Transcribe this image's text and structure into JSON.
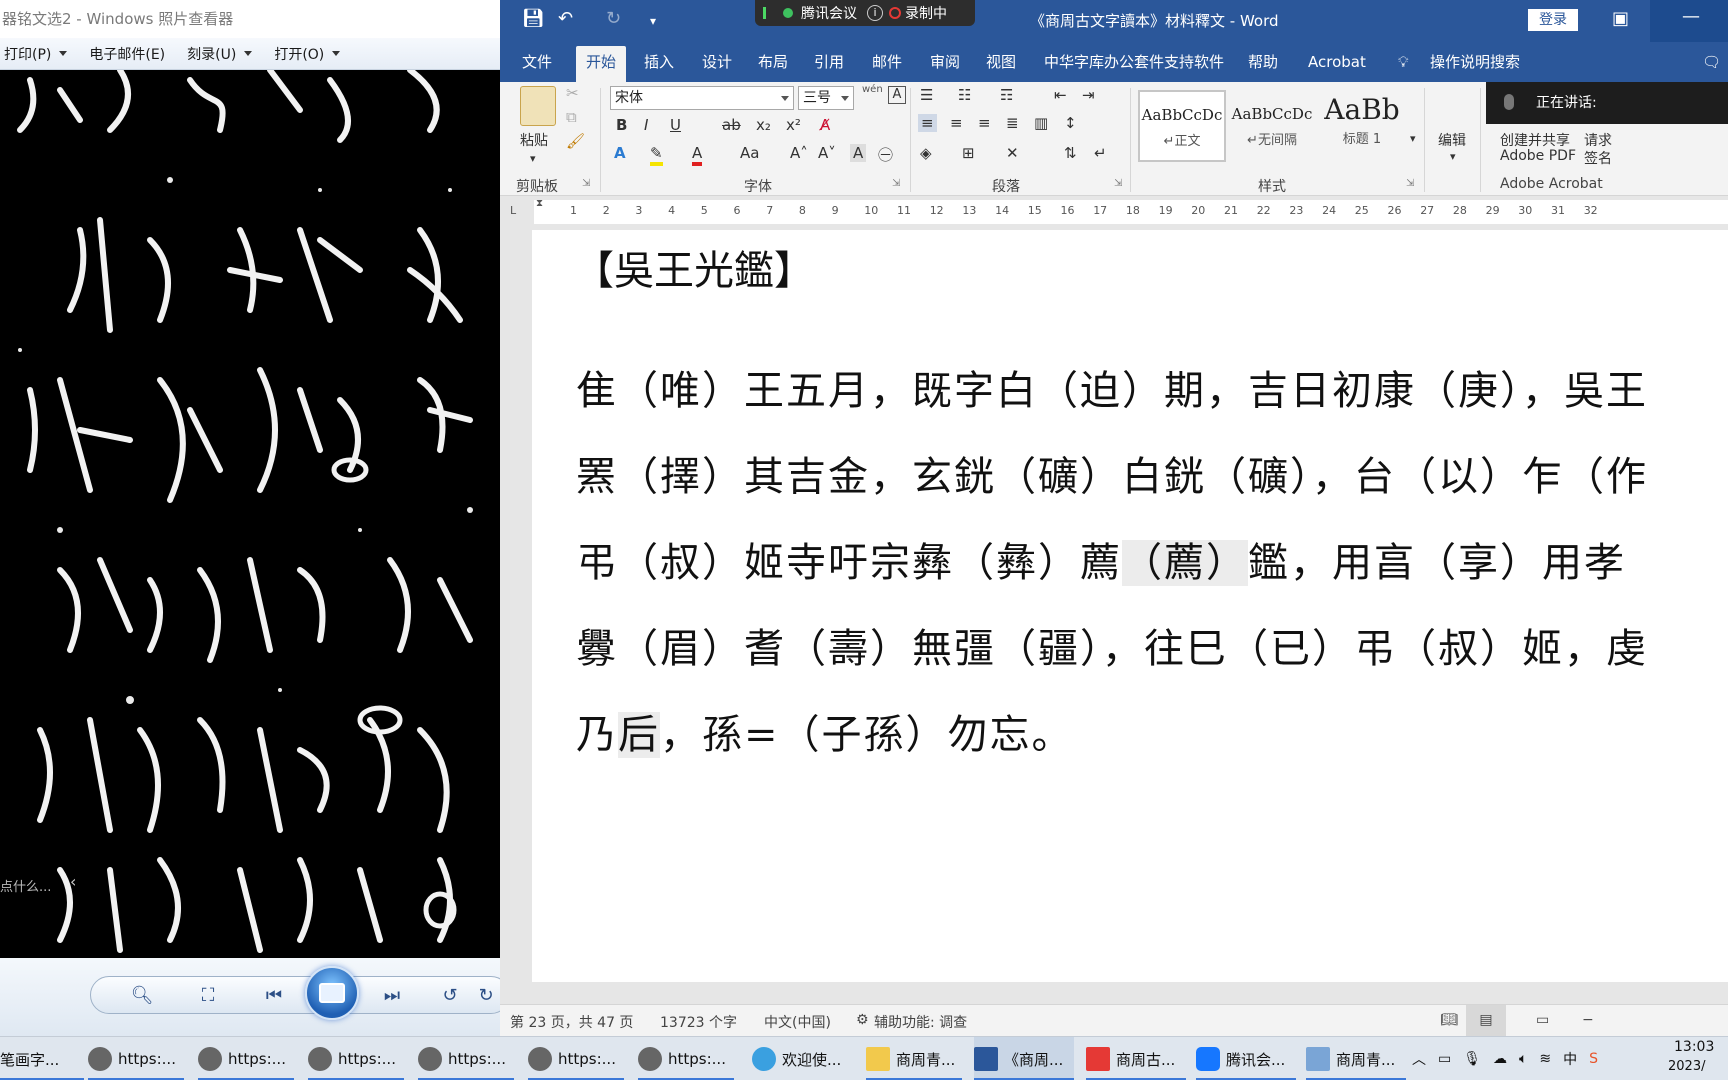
{
  "photo_viewer": {
    "title": "器铭文选2 - Windows 照片查看器",
    "menus": [
      {
        "label": "打印(P)"
      },
      {
        "label": "电子邮件(E)"
      },
      {
        "label": "刻录(U)"
      },
      {
        "label": "打开(O)"
      }
    ],
    "side_hint": "点什么..."
  },
  "word": {
    "window_title": "《商周古文字讀本》材料釋文 - Word",
    "login_label": "登录",
    "meeting": {
      "app": "腾讯会议",
      "recording": "录制中"
    },
    "speaking_label": "正在讲话:",
    "tabs": [
      {
        "label": "文件"
      },
      {
        "label": "开始"
      },
      {
        "label": "插入"
      },
      {
        "label": "设计"
      },
      {
        "label": "布局"
      },
      {
        "label": "引用"
      },
      {
        "label": "邮件"
      },
      {
        "label": "审阅"
      },
      {
        "label": "视图"
      },
      {
        "label": "中华字库办公套件支持软件"
      },
      {
        "label": "帮助"
      },
      {
        "label": "Acrobat"
      },
      {
        "label": "操作说明搜索"
      }
    ],
    "ribbon": {
      "paste_label": "粘贴",
      "clipboard_group": "剪贴板",
      "font_name": "宋体",
      "font_size": "三号",
      "font_group": "字体",
      "paragraph_group": "段落",
      "styles_group": "样式",
      "styles": [
        {
          "sample": "AaBbCcDc",
          "name": "↵正文"
        },
        {
          "sample": "AaBbCcDc",
          "name": "↵无间隔"
        },
        {
          "sample": "AaBb",
          "name": "标题 1"
        }
      ],
      "edit_label": "编辑",
      "adobe_create": "创建并共享",
      "adobe_pdf": "Adobe PDF",
      "adobe_request": "请求",
      "adobe_sign": "签名",
      "adobe_group": "Adobe Acrobat",
      "wen_label": "wén"
    },
    "ruler_numbers": [
      "1",
      "2",
      "3",
      "4",
      "5",
      "6",
      "7",
      "8",
      "9",
      "10",
      "11",
      "12",
      "13",
      "14",
      "15",
      "16",
      "17",
      "18",
      "19",
      "20",
      "21",
      "22",
      "23",
      "24",
      "25",
      "26",
      "27",
      "28",
      "29",
      "30",
      "31",
      "32"
    ],
    "document": {
      "title": "【吳王光鑑】",
      "lines": [
        {
          "pre": "隹（唯）王五月，既字白（迫）期，吉日初康（庚），吳王",
          "hl": "",
          "post": ""
        },
        {
          "pre": "罴（擇）其吉金，玄銧（礦）白銧（礦），台（以）乍（作",
          "hl": "",
          "post": ""
        },
        {
          "pre": "弔（叔）姬寺吁宗彝（彝）薦",
          "hl": "（薦）",
          "post": "鑑，用亯（享）用孝"
        },
        {
          "pre": "釁（眉）耆（壽）無彊（疆），往巳（已）弔（叔）姬，虔",
          "hl": "",
          "post": ""
        },
        {
          "pre": "乃",
          "hl": "后",
          "post": "，孫=（子孫）勿忘。"
        }
      ]
    },
    "status": {
      "page": "第 23 页，共 47 页",
      "words": "13723 个字",
      "language": "中文(中国)",
      "accessibility": "辅助功能: 调查"
    }
  },
  "taskbar": {
    "items": [
      {
        "label": "笔画字..."
      },
      {
        "label": "https:..."
      },
      {
        "label": "https:..."
      },
      {
        "label": "https:..."
      },
      {
        "label": "https:..."
      },
      {
        "label": "https:..."
      },
      {
        "label": "https:..."
      },
      {
        "label": "欢迎使..."
      },
      {
        "label": "商周青..."
      },
      {
        "label": "《商周..."
      },
      {
        "label": "商周古..."
      },
      {
        "label": "腾讯会..."
      },
      {
        "label": "商周青..."
      }
    ],
    "ime": "中",
    "clock_time": "13:03",
    "clock_date": "2023/"
  }
}
